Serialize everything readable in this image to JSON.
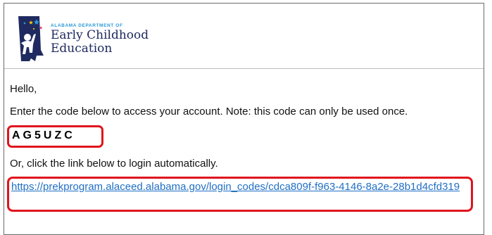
{
  "logo": {
    "department": "ALABAMA DEPARTMENT OF",
    "line1": "Early Childhood",
    "line2": "Education"
  },
  "email": {
    "greeting": "Hello,",
    "instruction": "Enter the code below to access your account. Note: this code can only be used once.",
    "code": "AG5UZC",
    "alt_instruction": "Or, click the link below to login automatically.",
    "link": "https://prekprogram.alaceed.alabama.gov/login_codes/cdca809f-f963-4146-8a2e-28b1d4cfd319"
  },
  "colors": {
    "highlight": "#e0141c",
    "link": "#1f6fc4",
    "brand_navy": "#1f2a60",
    "brand_blue": "#2a9ad6"
  }
}
